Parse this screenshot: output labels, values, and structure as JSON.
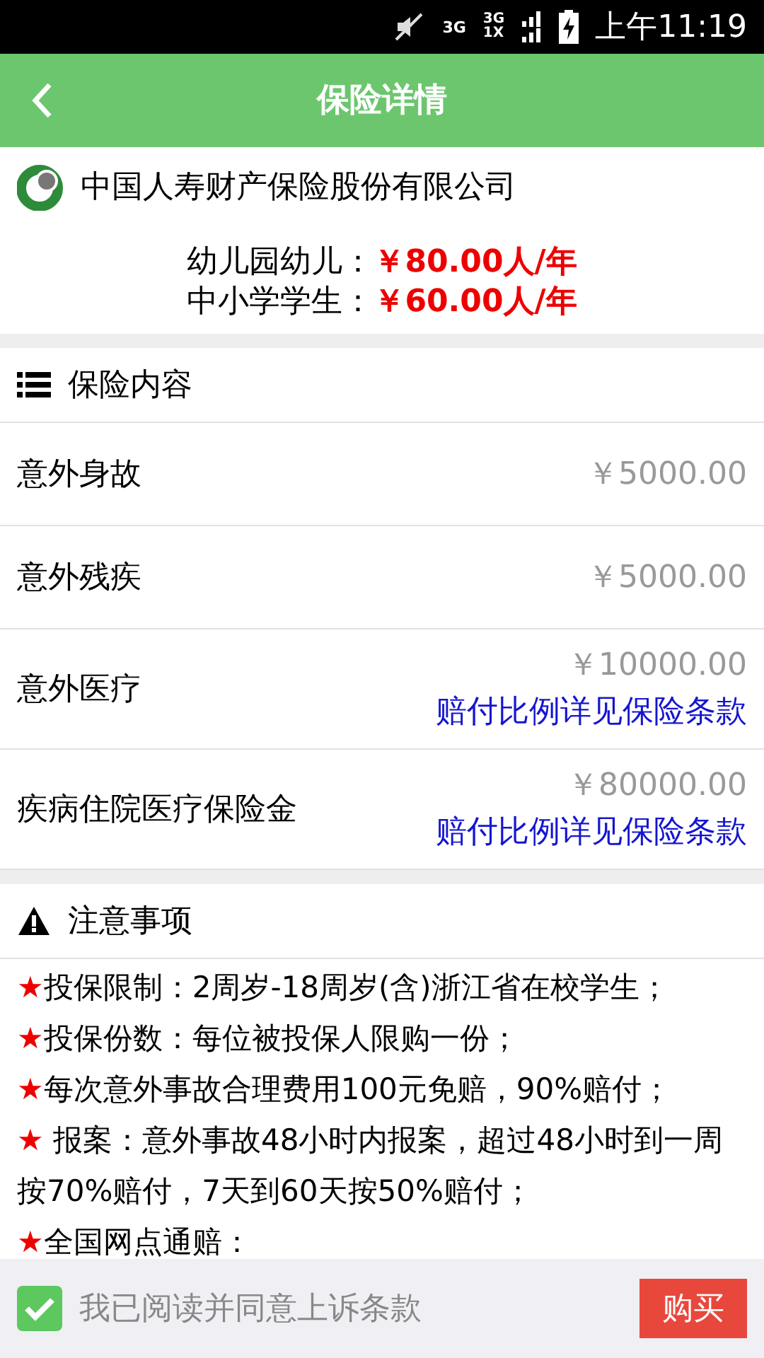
{
  "status_bar": {
    "network_1": "3G",
    "network_2": "3G",
    "network_3": "1X",
    "time": "上午11:19"
  },
  "header": {
    "title": "保险详情"
  },
  "company": {
    "name": "中国人寿财产保险股份有限公司"
  },
  "prices": [
    {
      "label": "幼儿园幼儿：",
      "value": "￥80.00人/年"
    },
    {
      "label": "中小学学生：",
      "value": "￥60.00人/年"
    }
  ],
  "coverage": {
    "title": "保险内容",
    "rows": [
      {
        "name": "意外身故",
        "amount": "￥5000.00"
      },
      {
        "name": "意外残疾",
        "amount": "￥5000.00"
      },
      {
        "name": "意外医疗",
        "amount": "￥10000.00",
        "link": "赔付比例详见保险条款"
      },
      {
        "name": "疾病住院医疗保险金",
        "amount": "￥80000.00",
        "link": "赔付比例详见保险条款"
      }
    ]
  },
  "notes": {
    "title": "注意事项",
    "items": [
      {
        "mark": "★",
        "text": "投保限制：2周岁-18周岁(含)浙江省在校学生；"
      },
      {
        "mark": "★",
        "text": "投保份数：每位被投保人限购一份；"
      },
      {
        "mark": "★",
        "text": "每次意外事故合理费用100元免赔，90%赔付；"
      },
      {
        "mark": "★",
        "text": " 报案：意外事故48小时内报案，超过48小时到一周按70%赔付，7天到60天按50%赔付；"
      },
      {
        "mark": "★",
        "text": "全国网点通赔："
      }
    ]
  },
  "footer": {
    "agree": {
      "label": "我已阅读并同意上诉条款",
      "checked": true
    },
    "buy_button": "购买"
  }
}
